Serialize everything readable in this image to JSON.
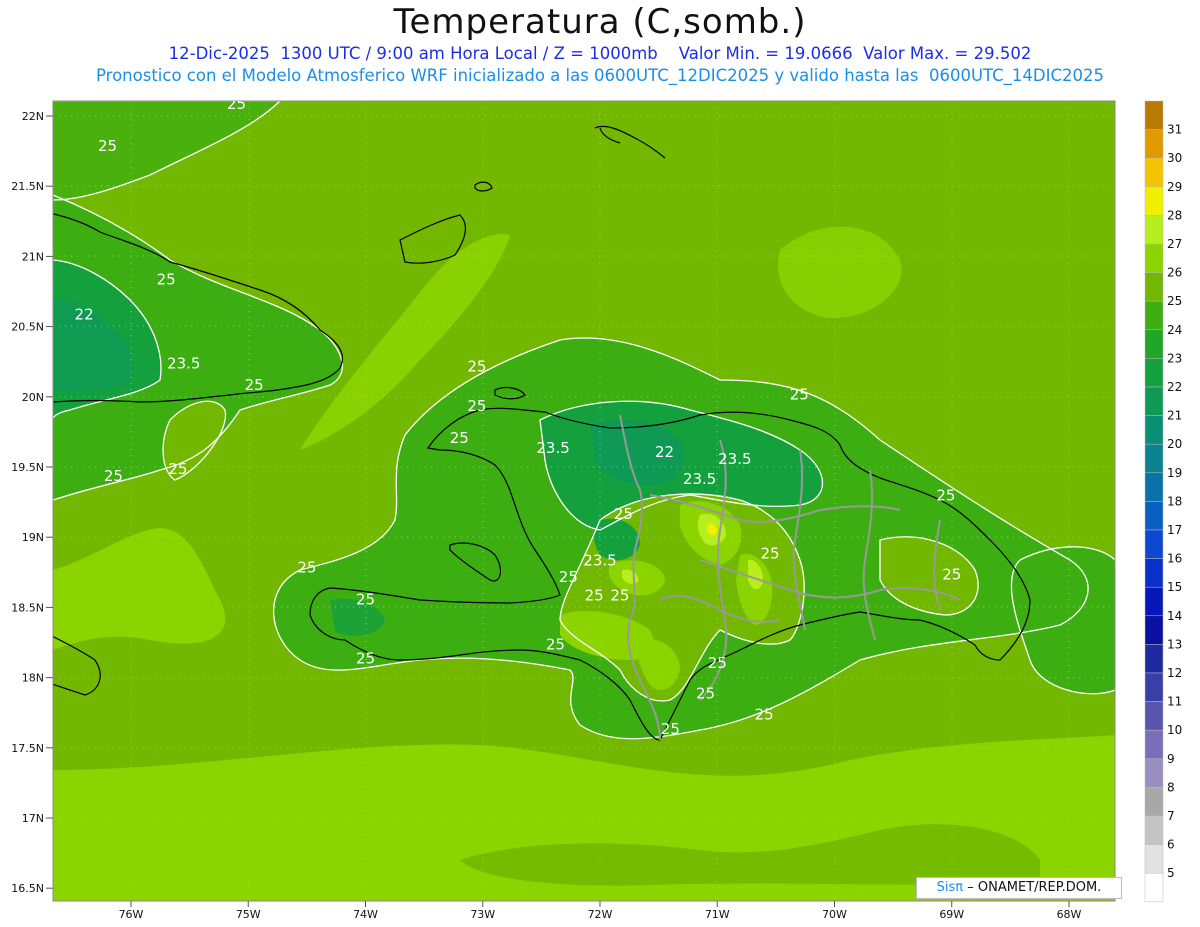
{
  "title": "Temperatura (C,somb.)",
  "subtitle1": "12-Dic-2025  1300 UTC / 9:00 am Hora Local / Z = 1000mb    Valor Min. = 19.0666  Valor Max. = 29.502",
  "subtitle2": "Pronostico con el Modelo Atmosferico WRF inicializado a las 0600UTC_12DIC2025 y valido hasta las  0600UTC_14DIC2025",
  "credit": {
    "logo": "Sisπ",
    "text": "– ONAMET/REP.DOM."
  },
  "lat_labels": [
    "22N",
    "21.5N",
    "21N",
    "20.5N",
    "20N",
    "19.5N",
    "19N",
    "18.5N",
    "18N",
    "17.5N",
    "17N",
    "16.5N"
  ],
  "lon_labels": [
    "76W",
    "75W",
    "74W",
    "73W",
    "72W",
    "71W",
    "70W",
    "69W",
    "68W"
  ],
  "legend": [
    {
      "v": "31",
      "c": "#b87a00"
    },
    {
      "v": "30",
      "c": "#e09a00"
    },
    {
      "v": "29",
      "c": "#f5c400"
    },
    {
      "v": "28",
      "c": "#f0f000"
    },
    {
      "v": "27",
      "c": "#b8ee1e"
    },
    {
      "v": "26",
      "c": "#8cd400"
    },
    {
      "v": "25",
      "c": "#72b800"
    },
    {
      "v": "24",
      "c": "#3cae12"
    },
    {
      "v": "23",
      "c": "#22a628"
    },
    {
      "v": "22",
      "c": "#15a03e"
    },
    {
      "v": "21",
      "c": "#0e9a55"
    },
    {
      "v": "20",
      "c": "#0a8f74"
    },
    {
      "v": "19",
      "c": "#0a8290"
    },
    {
      "v": "18",
      "c": "#0a72a8"
    },
    {
      "v": "17",
      "c": "#0b5fc0"
    },
    {
      "v": "16",
      "c": "#0c48d0"
    },
    {
      "v": "15",
      "c": "#0a30cc"
    },
    {
      "v": "14",
      "c": "#0818b8"
    },
    {
      "v": "13",
      "c": "#0a10a0"
    },
    {
      "v": "12",
      "c": "#1e2aa0"
    },
    {
      "v": "11",
      "c": "#3a3ea8"
    },
    {
      "v": "10",
      "c": "#5a56b0"
    },
    {
      "v": "9",
      "c": "#7a6eb8"
    },
    {
      "v": "8",
      "c": "#9a8ec0"
    },
    {
      "v": "7",
      "c": "#a8a8a8"
    },
    {
      "v": "6",
      "c": "#c4c4c4"
    },
    {
      "v": "5",
      "c": "#e2e2e2"
    },
    {
      "v": "",
      "c": "#ffffff"
    }
  ],
  "contour_labels": [
    {
      "t": "25",
      "lon": -75.1,
      "lat": 22.05
    },
    {
      "t": "25",
      "lon": -76.2,
      "lat": 21.75
    },
    {
      "t": "25",
      "lon": -75.7,
      "lat": 20.8
    },
    {
      "t": "22",
      "lon": -76.4,
      "lat": 20.55
    },
    {
      "t": "23.5",
      "lon": -75.55,
      "lat": 20.2
    },
    {
      "t": "25",
      "lon": -74.95,
      "lat": 20.05
    },
    {
      "t": "25",
      "lon": -76.15,
      "lat": 19.4
    },
    {
      "t": "25",
      "lon": -75.6,
      "lat": 19.45
    },
    {
      "t": "25",
      "lon": -73.05,
      "lat": 20.18
    },
    {
      "t": "25",
      "lon": -73.05,
      "lat": 19.9
    },
    {
      "t": "25",
      "lon": -73.2,
      "lat": 19.67
    },
    {
      "t": "23.5",
      "lon": -72.4,
      "lat": 19.6
    },
    {
      "t": "22",
      "lon": -71.45,
      "lat": 19.57
    },
    {
      "t": "23.5",
      "lon": -70.85,
      "lat": 19.52
    },
    {
      "t": "23.5",
      "lon": -71.15,
      "lat": 19.38
    },
    {
      "t": "25",
      "lon": -70.3,
      "lat": 19.98
    },
    {
      "t": "25",
      "lon": -69.05,
      "lat": 19.26
    },
    {
      "t": "25",
      "lon": -71.8,
      "lat": 19.13
    },
    {
      "t": "25",
      "lon": -70.55,
      "lat": 18.85
    },
    {
      "t": "23.5",
      "lon": -72.0,
      "lat": 18.8
    },
    {
      "t": "25",
      "lon": -74.5,
      "lat": 18.75
    },
    {
      "t": "25",
      "lon": -74.0,
      "lat": 18.52
    },
    {
      "t": "25",
      "lon": -72.27,
      "lat": 18.68
    },
    {
      "t": "25",
      "lon": -72.05,
      "lat": 18.55
    },
    {
      "t": "25",
      "lon": -71.83,
      "lat": 18.55
    },
    {
      "t": "25",
      "lon": -69.0,
      "lat": 18.7
    },
    {
      "t": "25",
      "lon": -67.52,
      "lat": 18.97
    },
    {
      "t": "25",
      "lon": -72.38,
      "lat": 18.2
    },
    {
      "t": "25",
      "lon": -74.0,
      "lat": 18.1
    },
    {
      "t": "25",
      "lon": -71.0,
      "lat": 18.07
    },
    {
      "t": "25",
      "lon": -71.1,
      "lat": 17.85
    },
    {
      "t": "25",
      "lon": -71.4,
      "lat": 17.6
    },
    {
      "t": "25",
      "lon": -70.6,
      "lat": 17.7
    }
  ]
}
